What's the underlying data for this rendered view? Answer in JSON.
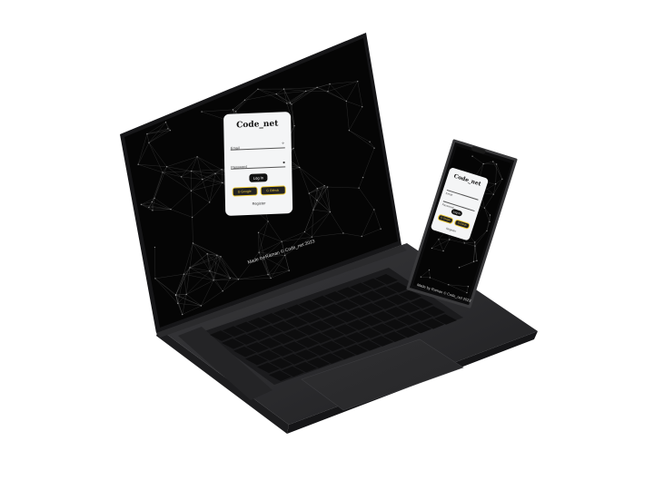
{
  "login_card": {
    "title": "Code_net",
    "email_label": "Email",
    "password_label": "Password",
    "login_button": "Log In",
    "social_1": "G Google",
    "social_2": "G Github",
    "register_link": "Register"
  },
  "phone_card": {
    "title": "Code_net",
    "email_label": "Email",
    "password_label": "Password",
    "login_button": "Log In",
    "social_1": "G Google",
    "social_2": "G Github",
    "register_link": "Register"
  },
  "laptop_footer": "Made by Raman © Code_net 2023",
  "phone_footer": "Made by Raman © Code_net 2023",
  "colors": {
    "screen_bg": "#050505",
    "device_body": "#2b2b2d",
    "accent_yellow": "#f2cf3c",
    "card_bg": "#f4f5f6"
  }
}
